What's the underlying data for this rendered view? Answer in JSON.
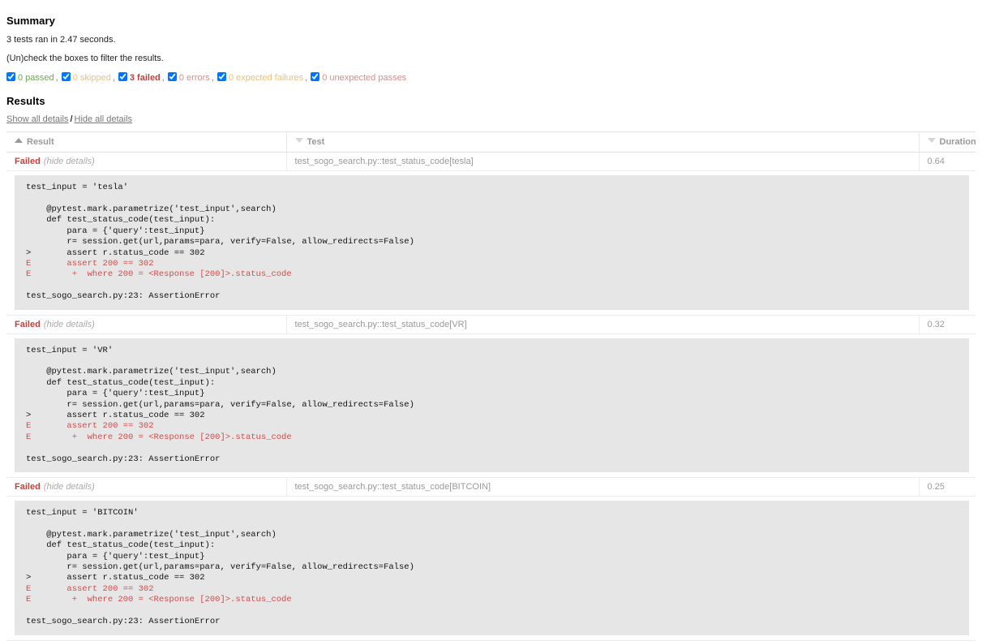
{
  "summary": {
    "title": "Summary",
    "run_line": "3 tests ran in 2.47 seconds.",
    "filter_hint": "(Un)check the boxes to filter the results.",
    "filters": [
      {
        "label": "0 passed",
        "checked": true,
        "kind": "passed",
        "sep": ","
      },
      {
        "label": "0 skipped",
        "checked": true,
        "kind": "skipped",
        "sep": ","
      },
      {
        "label": "3 failed",
        "checked": true,
        "kind": "failed",
        "sep": ","
      },
      {
        "label": "0 errors",
        "checked": true,
        "kind": "error",
        "sep": ","
      },
      {
        "label": "0 expected failures",
        "checked": true,
        "kind": "xfailed",
        "sep": ","
      },
      {
        "label": "0 unexpected passes",
        "checked": true,
        "kind": "xpassed",
        "sep": ""
      }
    ]
  },
  "results": {
    "title": "Results",
    "show_all_label": "Show all details",
    "separator": "/",
    "hide_all_label": "Hide all details",
    "columns": [
      {
        "label": "Result",
        "sort": "asc"
      },
      {
        "label": "Test",
        "sort": "desc"
      },
      {
        "label": "Duration",
        "sort": "desc"
      }
    ],
    "rows": [
      {
        "status": "Failed",
        "toggle": "(hide details)",
        "test": "test_sogo_search.py::test_status_code[tesla]",
        "duration": "0.64",
        "log": {
          "header": "test_input = 'tesla'",
          "code": [
            "    @pytest.mark.parametrize('test_input',search)",
            "    def test_status_code(test_input):",
            "        para = {'query':test_input}",
            "        r= session.get(url,params=para, verify=False, allow_redirects=False)",
            ">       assert r.status_code == 302"
          ],
          "errors": [
            "E       assert 200 == 302",
            "E        +  where 200 = <Response [200]>.status_code"
          ],
          "footer": "test_sogo_search.py:23: AssertionError"
        }
      },
      {
        "status": "Failed",
        "toggle": "(hide details)",
        "test": "test_sogo_search.py::test_status_code[VR]",
        "duration": "0.32",
        "log": {
          "header": "test_input = 'VR'",
          "code": [
            "    @pytest.mark.parametrize('test_input',search)",
            "    def test_status_code(test_input):",
            "        para = {'query':test_input}",
            "        r= session.get(url,params=para, verify=False, allow_redirects=False)",
            ">       assert r.status_code == 302"
          ],
          "errors": [
            "E       assert 200 == 302",
            "E        +  where 200 = <Response [200]>.status_code"
          ],
          "footer": "test_sogo_search.py:23: AssertionError"
        }
      },
      {
        "status": "Failed",
        "toggle": "(hide details)",
        "test": "test_sogo_search.py::test_status_code[BITCOIN]",
        "duration": "0.25",
        "log": {
          "header": "test_input = 'BITCOIN'",
          "code": [
            "    @pytest.mark.parametrize('test_input',search)",
            "    def test_status_code(test_input):",
            "        para = {'query':test_input}",
            "        r= session.get(url,params=para, verify=False, allow_redirects=False)",
            ">       assert r.status_code == 302"
          ],
          "errors": [
            "E       assert 200 == 302",
            "E        +  where 200 = <Response [200]>.status_code"
          ],
          "footer": "test_sogo_search.py:23: AssertionError"
        }
      }
    ]
  },
  "colors": {
    "passed": "#6aa84f",
    "failed": "#c1403d",
    "skipped": "#e8c07a",
    "log_bg": "#e6e6e6"
  }
}
